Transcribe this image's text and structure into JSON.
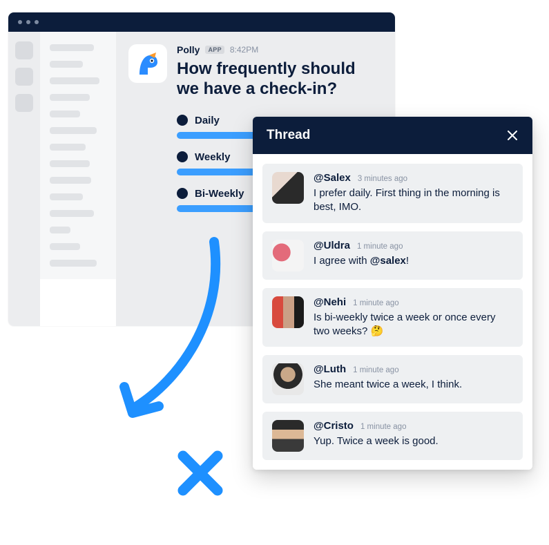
{
  "poll": {
    "app_name": "Polly",
    "app_badge": "APP",
    "timestamp": "8:42PM",
    "question": "How frequently should we have a check-in?",
    "options": [
      "Daily",
      "Weekly",
      "Bi-Weekly"
    ]
  },
  "thread": {
    "title": "Thread",
    "replies": [
      {
        "user": "@Salex",
        "time": "3 minutes ago",
        "text": "I prefer daily. First thing in the morning is best, IMO."
      },
      {
        "user": "@Uldra",
        "time": "1 minute ago",
        "text_pre": "I agree with ",
        "mention": "@salex",
        "text_post": "!"
      },
      {
        "user": "@Nehi",
        "time": "1 minute ago",
        "text": "Is bi-weekly twice a week or once every two weeks? 🤔"
      },
      {
        "user": "@Luth",
        "time": "1 minute ago",
        "text": "She meant twice a week, I think."
      },
      {
        "user": "@Cristo",
        "time": "1 minute ago",
        "text": "Yup. Twice a week is good."
      }
    ]
  }
}
